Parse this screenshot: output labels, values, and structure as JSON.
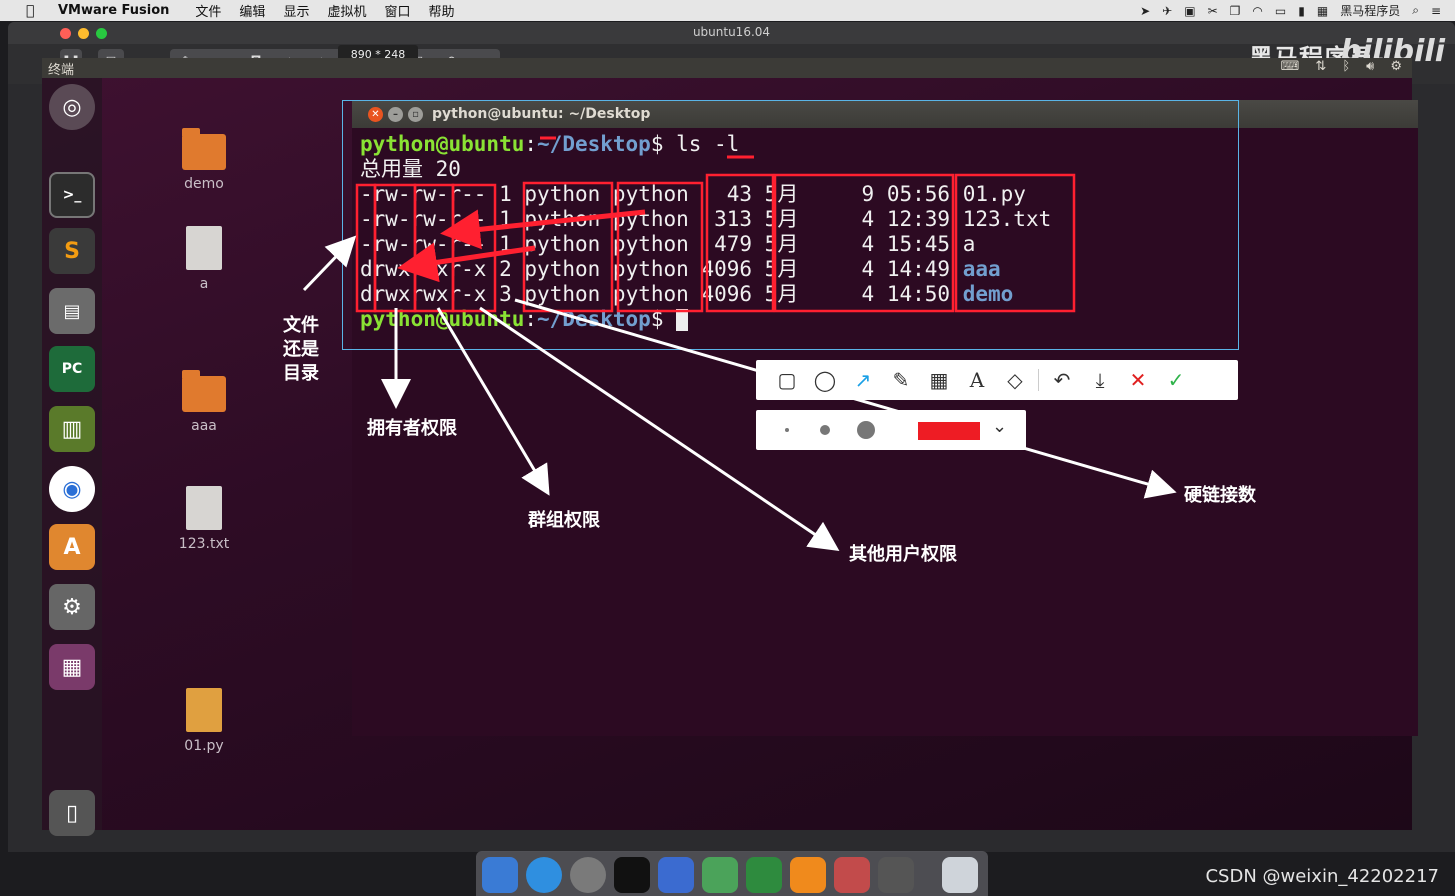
{
  "menubar": {
    "apple": "",
    "app": "VMware Fusion",
    "items": [
      "文件",
      "编辑",
      "显示",
      "虚拟机",
      "窗口",
      "帮助"
    ],
    "right_label": "黑马程序员"
  },
  "vmware": {
    "window_title": "ubuntu16.04",
    "size_tooltip": "890 * 248",
    "brand": "黑马程序员-",
    "brand_logo": "bilibili"
  },
  "ubuntu_panel": {
    "label": "终端"
  },
  "desktop_icons": [
    {
      "label": "demo",
      "type": "folder"
    },
    {
      "label": "a",
      "type": "file"
    },
    {
      "label": "aaa",
      "type": "folder"
    },
    {
      "label": "123.txt",
      "type": "file"
    },
    {
      "label": "01.py",
      "type": "python"
    }
  ],
  "terminal": {
    "title": "python@ubuntu: ~/Desktop",
    "prompt_user": "python@ubuntu",
    "prompt_path": "~/Desktop",
    "command": "$ ls -l",
    "total_line": "总用量 20",
    "rows": [
      {
        "perm": "-rw-rw-r--",
        "links": "1",
        "owner": "python",
        "group": "python",
        "size": "  43",
        "month": "5月",
        "day": " 9",
        "time": "05:56",
        "name": "01.py",
        "dir": false
      },
      {
        "perm": "-rw-rw-r--",
        "links": "1",
        "owner": "python",
        "group": "python",
        "size": " 313",
        "month": "5月",
        "day": " 4",
        "time": "12:39",
        "name": "123.txt",
        "dir": false
      },
      {
        "perm": "-rw-rw-r--",
        "links": "1",
        "owner": "python",
        "group": "python",
        "size": " 479",
        "month": "5月",
        "day": " 4",
        "time": "15:45",
        "name": "a",
        "dir": false
      },
      {
        "perm": "drwxrwxr-x",
        "links": "2",
        "owner": "python",
        "group": "python",
        "size": "4096",
        "month": "5月",
        "day": " 4",
        "time": "14:49",
        "name": "aaa",
        "dir": true
      },
      {
        "perm": "drwxrwxr-x",
        "links": "3",
        "owner": "python",
        "group": "python",
        "size": "4096",
        "month": "5月",
        "day": " 4",
        "time": "14:50",
        "name": "demo",
        "dir": true
      }
    ],
    "final_prompt": "$ "
  },
  "annotations": {
    "file_or_dir": "文件\n还是\n目录",
    "owner_perm": "拥有者权限",
    "group_perm": "群组权限",
    "other_perm": "其他用户权限",
    "hard_links": "硬链接数"
  },
  "anno_toolbar": {
    "tools": [
      "rect-tool",
      "ellipse-tool",
      "arrow-tool",
      "pen-tool",
      "mosaic-tool",
      "text-tool",
      "tag-tool",
      "undo",
      "download",
      "cancel",
      "confirm"
    ],
    "selected_color": "#ee1c24"
  },
  "watermark": "CSDN @weixin_42202217"
}
